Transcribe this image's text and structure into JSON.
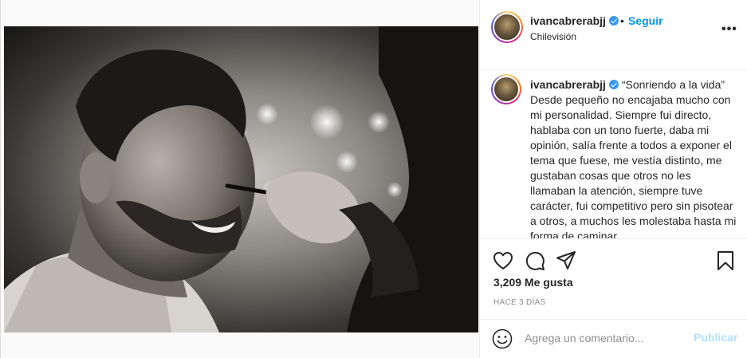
{
  "post": {
    "username": "ivancabrerabjj",
    "follow_label": "Seguir",
    "separator": "•",
    "location": "Chilevisión",
    "more_label": "•••",
    "caption_quote": "“Sonriendo a la vida”",
    "caption_body": "Desde pequeño no encajaba mucho con mi personalidad. Siempre fui directo, hablaba con un tono fuerte, daba mi opinión, salía frente a todos a exponer el tema que fuese, me vestía distinto, me gustaban cosas que otros no les llamaban la atención, siempre tuve carácter, fui competitivo pero sin pisotear a otros, a muchos les molestaba hasta mi forma de caminar",
    "likes": "3,209 Me gusta",
    "time_ago": "HACE 3 DÍAS",
    "comment_placeholder": "Agrega un comentario...",
    "publish_label": "Publicar"
  },
  "icons": {
    "like": "heart-icon",
    "comment": "comment-icon",
    "share": "paper-plane-icon",
    "save": "bookmark-icon",
    "emoji": "smiley-icon",
    "verified": "verified-badge-icon"
  },
  "colors": {
    "accent": "#0095f6",
    "verified": "#3897f0",
    "publish_disabled": "#b2dffc",
    "muted_text": "#8e8e8e"
  }
}
